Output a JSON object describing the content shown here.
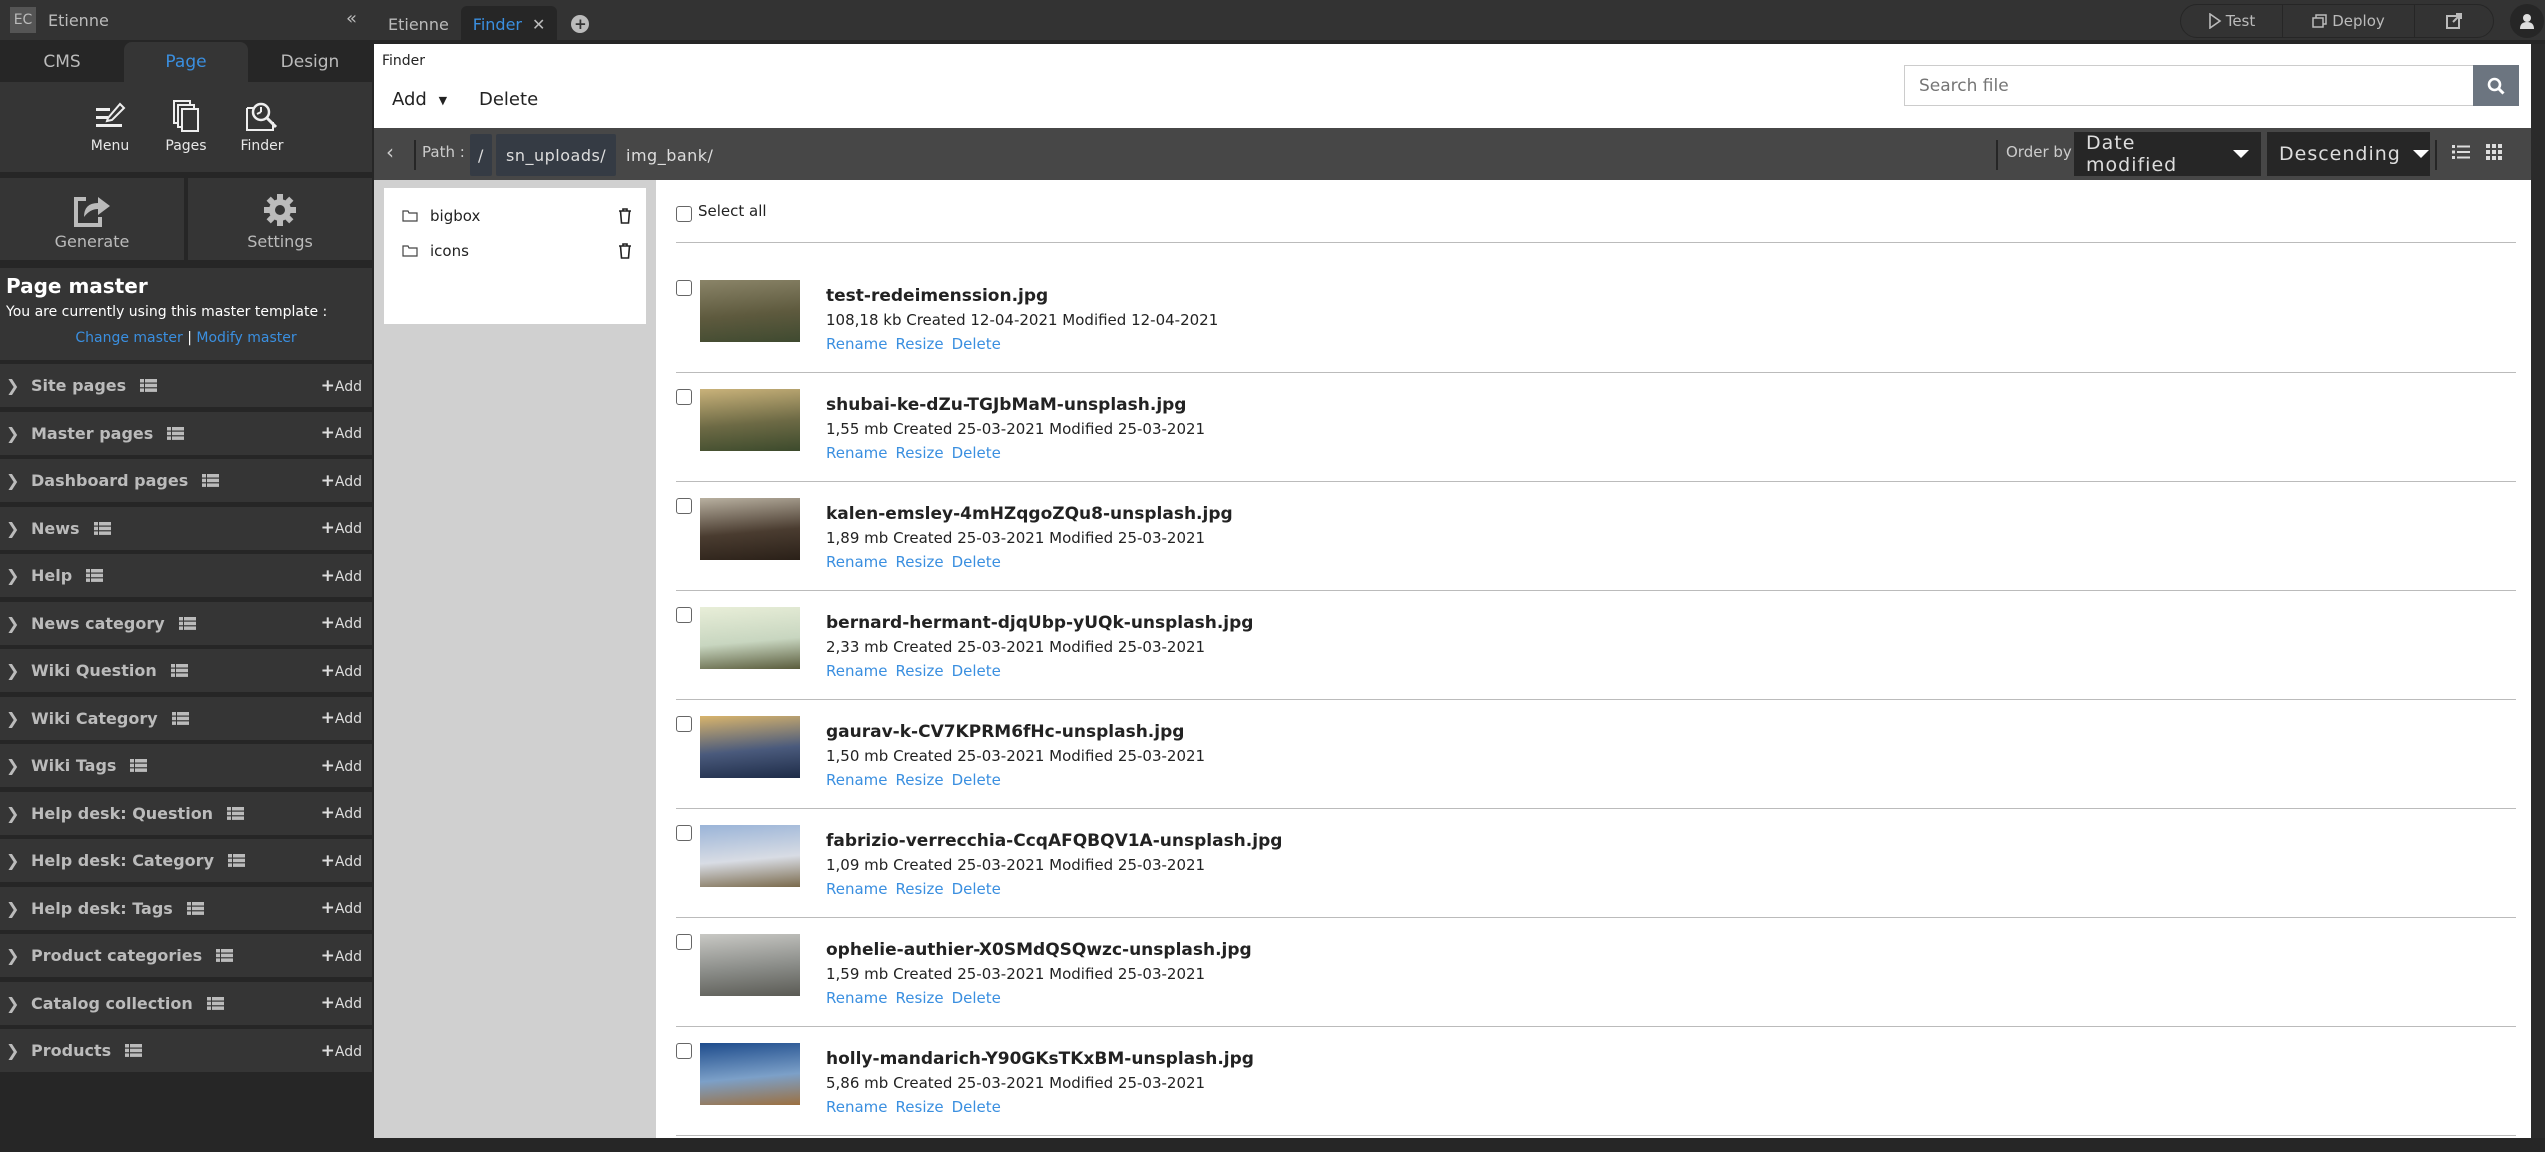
{
  "topbar": {
    "initials": "EC",
    "username": "Etienne",
    "tabs": [
      {
        "label": "Etienne",
        "active": false
      },
      {
        "label": "Finder",
        "active": true,
        "closable": true
      }
    ],
    "actions": {
      "test": "Test",
      "deploy": "Deploy"
    }
  },
  "sidebar": {
    "tabs": [
      "CMS",
      "Page",
      "Design"
    ],
    "active_tab": "Page",
    "tools": [
      "Menu",
      "Pages",
      "Finder"
    ],
    "big_tools": [
      "Generate",
      "Settings"
    ],
    "master": {
      "title": "Page master",
      "text": "You are currently using this master template :",
      "change": "Change master",
      "separator": "|",
      "modify": "Modify master"
    },
    "add_label": "Add",
    "sections": [
      "Site pages",
      "Master pages",
      "Dashboard pages",
      "News",
      "Help",
      "News category",
      "Wiki Question",
      "Wiki Category",
      "Wiki Tags",
      "Help desk: Question",
      "Help desk: Category",
      "Help desk: Tags",
      "Product categories",
      "Catalog collection",
      "Products"
    ]
  },
  "finder": {
    "breadcrumb": "Finder",
    "add_label": "Add",
    "delete_label": "Delete",
    "search_placeholder": "Search file",
    "path_label": "Path :",
    "path": [
      "/",
      "sn_uploads/",
      "img_bank/"
    ],
    "order_by_label": "Order by",
    "order_by": "Date modified",
    "order_dir": "Descending",
    "folders": [
      "bigbox",
      "icons"
    ],
    "select_all": "Select all",
    "actions": [
      "Rename",
      "Resize",
      "Delete"
    ],
    "files": [
      {
        "name": "test-redeimenssion.jpg",
        "info": "108,18 kb Created 12-04-2021 Modified 12-04-2021",
        "colors": [
          "#8a8468",
          "#5e5a3e",
          "#3f4a30"
        ]
      },
      {
        "name": "shubai-ke-dZu-TGJbMaM-unsplash.jpg",
        "info": "1,55 mb Created 25-03-2021 Modified 25-03-2021",
        "colors": [
          "#c9b27a",
          "#6d6a45",
          "#3c4a2c"
        ]
      },
      {
        "name": "kalen-emsley-4mHZqgoZQu8-unsplash.jpg",
        "info": "1,89 mb Created 25-03-2021 Modified 25-03-2021",
        "colors": [
          "#b8b0a0",
          "#4a3c30",
          "#2a2018"
        ]
      },
      {
        "name": "bernard-hermant-djqUbp-yUQk-unsplash.jpg",
        "info": "2,33 mb Created 25-03-2021 Modified 25-03-2021",
        "colors": [
          "#e8eed8",
          "#c8d6c0",
          "#5a5c3c"
        ]
      },
      {
        "name": "gaurav-k-CV7KPRM6fHc-unsplash.jpg",
        "info": "1,50 mb Created 25-03-2021 Modified 25-03-2021",
        "colors": [
          "#d8b46c",
          "#4a5a7c",
          "#1e2c48"
        ]
      },
      {
        "name": "fabrizio-verrecchia-CcqAFQBQV1A-unsplash.jpg",
        "info": "1,09 mb Created 25-03-2021 Modified 25-03-2021",
        "colors": [
          "#9ab4d8",
          "#d8dce4",
          "#7a6a4c"
        ]
      },
      {
        "name": "ophelie-authier-X0SMdQSQwzc-unsplash.jpg",
        "info": "1,59 mb Created 25-03-2021 Modified 25-03-2021",
        "colors": [
          "#c8c8c4",
          "#8a8c88",
          "#5a5a54"
        ]
      },
      {
        "name": "holly-mandarich-Y90GKsTKxBM-unsplash.jpg",
        "info": "5,86 mb Created 25-03-2021 Modified 25-03-2021",
        "colors": [
          "#1e4c8c",
          "#7ca0c8",
          "#9c7040"
        ]
      }
    ]
  }
}
